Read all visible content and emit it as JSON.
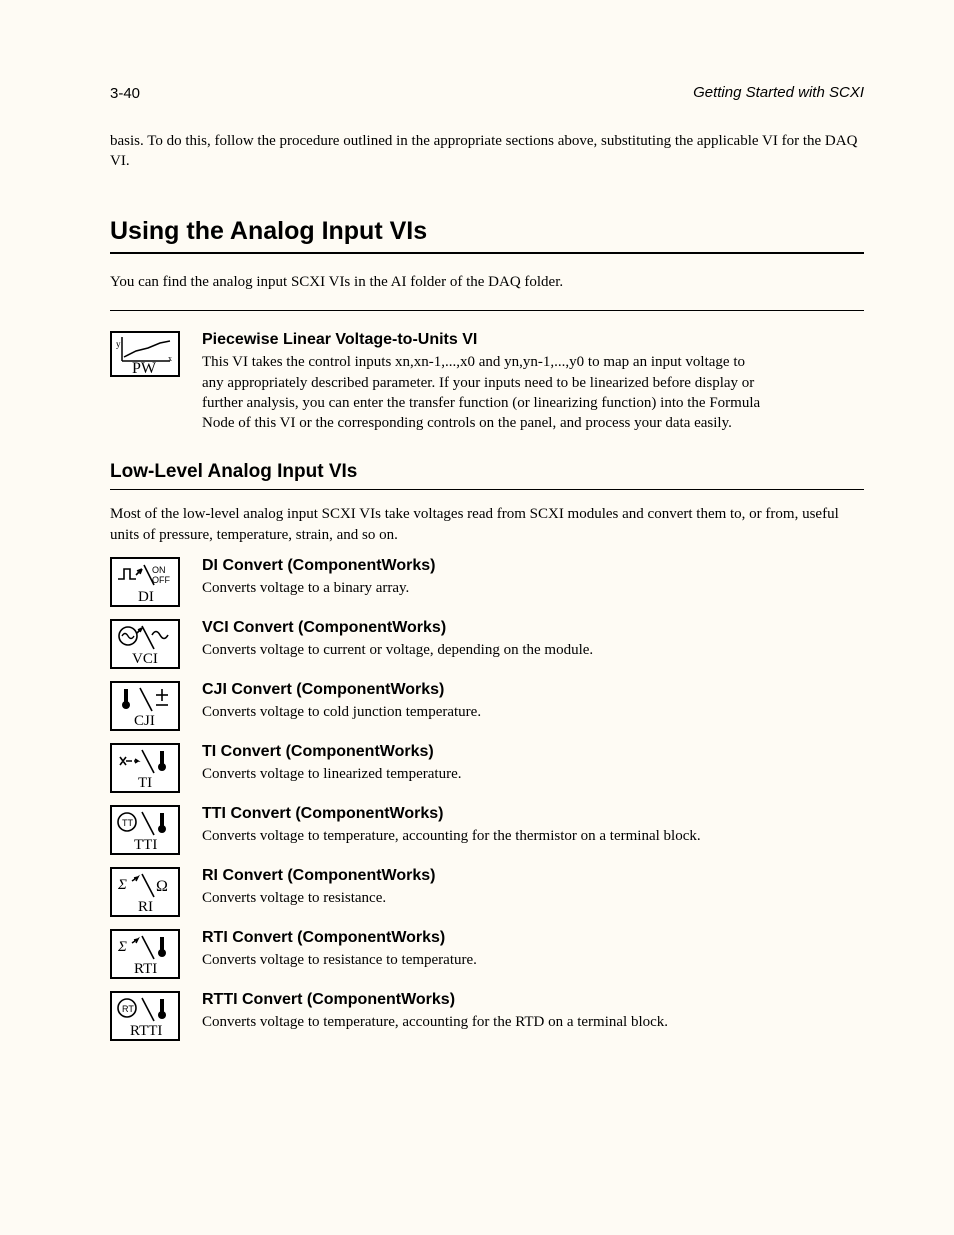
{
  "page_number": "3-40",
  "book_title": "Getting Started with SCXI",
  "intro_para": "basis. To do this, follow the procedure outlined in the appropriate sections above, substituting the applicable VI for the DAQ VI.",
  "section_title": "Using the Analog Input VIs",
  "after_thick_rule_para": "You can find the analog input SCXI VIs in the AI folder of the DAQ folder.",
  "pw_block": {
    "title": "Piecewise Linear Voltage-to-Units VI",
    "body": "This VI takes the control inputs xn,xn-1,...,x0 and yn,yn-1,...,y0 to map an input voltage to any appropriately described parameter. If your inputs need to be linearized before display or further analysis, you can enter the transfer function (or linearizing function) into the Formula Node of this VI or the corresponding controls on the panel, and process your data easily.",
    "icon_label": "PW"
  },
  "low_level_title": "Low-Level Analog Input VIs",
  "low_level_intro": "Most of the low-level analog input SCXI VIs take voltages read from SCXI modules and convert them to, or from, useful units of pressure, temperature, strain, and so on.",
  "vis": [
    {
      "name": "DI Convert (ComponentWorks)",
      "desc": "Converts voltage to a binary array.",
      "label": "DI",
      "icon": "DI"
    },
    {
      "name": "VCI Convert (ComponentWorks)",
      "desc": "Converts voltage to current or voltage, depending on the module.",
      "label": "VCI",
      "icon": "VCI"
    },
    {
      "name": "CJI Convert (ComponentWorks)",
      "desc": "Converts voltage to cold junction temperature.",
      "label": "CJI",
      "icon": "CJI"
    },
    {
      "name": "TI Convert (ComponentWorks)",
      "desc": "Converts voltage to linearized temperature.",
      "label": "TI",
      "icon": "TI"
    },
    {
      "name": "TTI Convert (ComponentWorks)",
      "desc": "Converts voltage to temperature, accounting for the thermistor on a terminal block.",
      "label": "TTI",
      "icon": "TTI"
    },
    {
      "name": "RI Convert (ComponentWorks)",
      "desc": "Converts voltage to resistance.",
      "label": "RI",
      "icon": "RI"
    },
    {
      "name": "RTI Convert (ComponentWorks)",
      "desc": "Converts voltage to resistance to temperature.",
      "label": "RTI",
      "icon": "RTI"
    },
    {
      "name": "RTTI Convert (ComponentWorks)",
      "desc": "Converts voltage to temperature, accounting for the RTD on a terminal block.",
      "label": "RTTI",
      "icon": "RTTI"
    }
  ]
}
